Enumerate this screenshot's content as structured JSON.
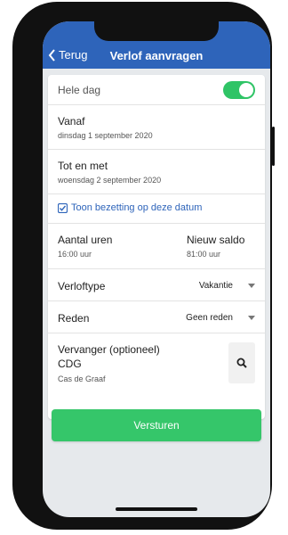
{
  "header": {
    "back_label": "Terug",
    "title": "Verlof aanvragen"
  },
  "form": {
    "whole_day": {
      "label": "Hele dag",
      "on": true
    },
    "from": {
      "label": "Vanaf",
      "value": "dinsdag 1 september 2020"
    },
    "until": {
      "label": "Tot en met",
      "value": "woensdag 2 september 2020"
    },
    "show_occupancy": {
      "label": "Toon bezetting op deze datum",
      "checked": true
    },
    "hours": {
      "label": "Aantal uren",
      "value": "16:00 uur"
    },
    "new_balance": {
      "label": "Nieuw saldo",
      "value": "81:00 uur"
    },
    "leave_type": {
      "label": "Verloftype",
      "value": "Vakantie"
    },
    "reason": {
      "label": "Reden",
      "value": "Geen reden"
    },
    "substitute": {
      "label": "Vervanger (optioneel)",
      "code": "CDG",
      "name": "Cas de Graaf"
    }
  },
  "submit_label": "Versturen",
  "colors": {
    "accent": "#2e64ba",
    "toggle_on": "#2fc466",
    "submit": "#35c66a"
  }
}
